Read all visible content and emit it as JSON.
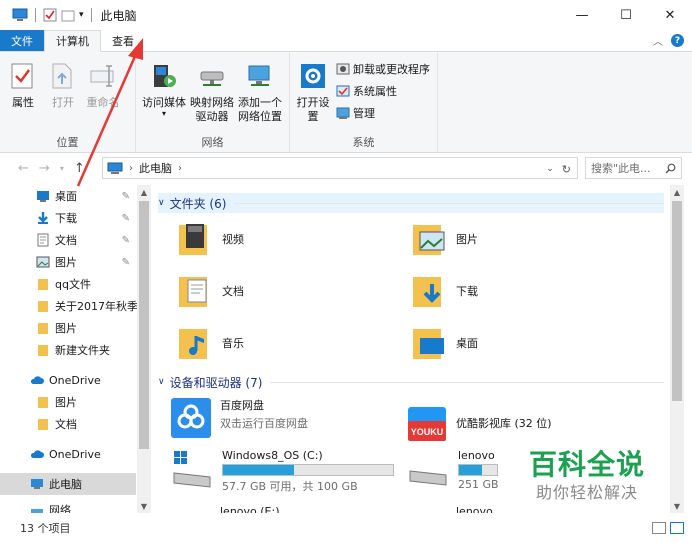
{
  "window": {
    "title": "此电脑",
    "minimize": "—",
    "maximize": "☐",
    "close": "✕"
  },
  "tabs": [
    {
      "label": "文件"
    },
    {
      "label": "计算机"
    },
    {
      "label": "查看"
    }
  ],
  "ribbon": {
    "location_group": {
      "label": "位置",
      "items": [
        {
          "label": "属性"
        },
        {
          "label": "打开"
        },
        {
          "label": "重命名"
        }
      ]
    },
    "network_group": {
      "label": "网络",
      "items": [
        {
          "label": "访问媒体"
        },
        {
          "label": "映射网络驱动器"
        },
        {
          "label": "添加一个网络位置"
        }
      ]
    },
    "system_group": {
      "label": "系统",
      "open_settings": "打开设置",
      "items": [
        {
          "label": "卸载或更改程序"
        },
        {
          "label": "系统属性"
        },
        {
          "label": "管理"
        }
      ]
    }
  },
  "address": {
    "path": "此电脑",
    "search_placeholder": "搜索\"此电...",
    "refresh": "↻"
  },
  "nav": {
    "items": [
      {
        "label": "桌面",
        "pinned": true
      },
      {
        "label": "下载",
        "pinned": true
      },
      {
        "label": "文档",
        "pinned": true
      },
      {
        "label": "图片",
        "pinned": true
      },
      {
        "label": "qq文件"
      },
      {
        "label": "关于2017年秋季"
      },
      {
        "label": "图片"
      },
      {
        "label": "新建文件夹"
      },
      {
        "label": "OneDrive"
      },
      {
        "label": "图片"
      },
      {
        "label": "文档"
      },
      {
        "label": "OneDrive"
      },
      {
        "label": "此电脑"
      },
      {
        "label": "网络"
      }
    ]
  },
  "content": {
    "folders_header": "文件夹 (6)",
    "folders": [
      {
        "label": "视频"
      },
      {
        "label": "图片"
      },
      {
        "label": "文档"
      },
      {
        "label": "下载"
      },
      {
        "label": "音乐"
      },
      {
        "label": "桌面"
      }
    ],
    "devices_header": "设备和驱动器 (7)",
    "devices": [
      {
        "name": "百度网盘",
        "sub": "双击运行百度网盘"
      },
      {
        "name": "优酷影视库 (32 位)"
      },
      {
        "name": "Windows8_OS (C:)",
        "sub": "57.7 GB 可用，共 100 GB",
        "used_fraction": 0.42
      },
      {
        "name": "lenovo",
        "sub": "251 GB"
      },
      {
        "name": "lenovo (E:)"
      },
      {
        "name": "lenovo"
      }
    ]
  },
  "status": {
    "count": "13 个项目"
  },
  "watermark": {
    "main": "百科全说",
    "sub": "助你轻松解决"
  },
  "colors": {
    "accent": "#1979ca",
    "highlight": "#e5f3ff",
    "folder": "#f2c14e",
    "arrow": "#e53935",
    "watermark": "#1aa24f"
  }
}
